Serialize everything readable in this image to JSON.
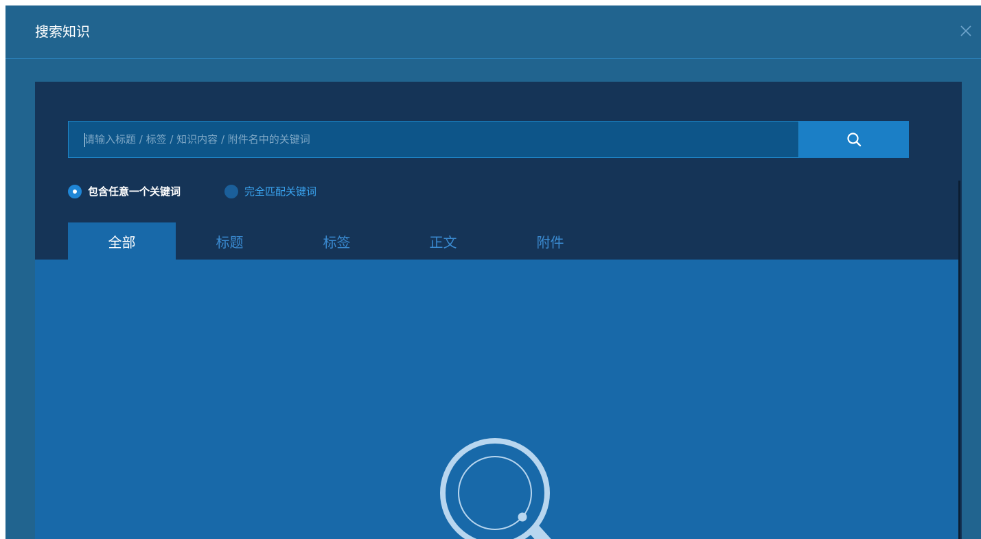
{
  "dialog": {
    "title": "搜索知识",
    "close_icon": "close-icon"
  },
  "search": {
    "placeholder": "请输入标题 / 标签 / 知识内容 / 附件名中的关键词",
    "value": "",
    "button_icon": "search-icon"
  },
  "match_options": [
    {
      "label": "包含任意一个关键词",
      "selected": true
    },
    {
      "label": "完全匹配关键词",
      "selected": false
    }
  ],
  "tabs": [
    {
      "label": "全部",
      "active": true
    },
    {
      "label": "标题",
      "active": false
    },
    {
      "label": "标签",
      "active": false
    },
    {
      "label": "正文",
      "active": false
    },
    {
      "label": "附件",
      "active": false
    }
  ],
  "results": {
    "empty_icon": "magnifier-empty-icon"
  },
  "colors": {
    "dialog_bg": "#21648f",
    "panel_bg": "#153457",
    "content_bg": "#1869a9",
    "accent": "#1b7fc6",
    "link_blue": "#3aa4f0"
  }
}
